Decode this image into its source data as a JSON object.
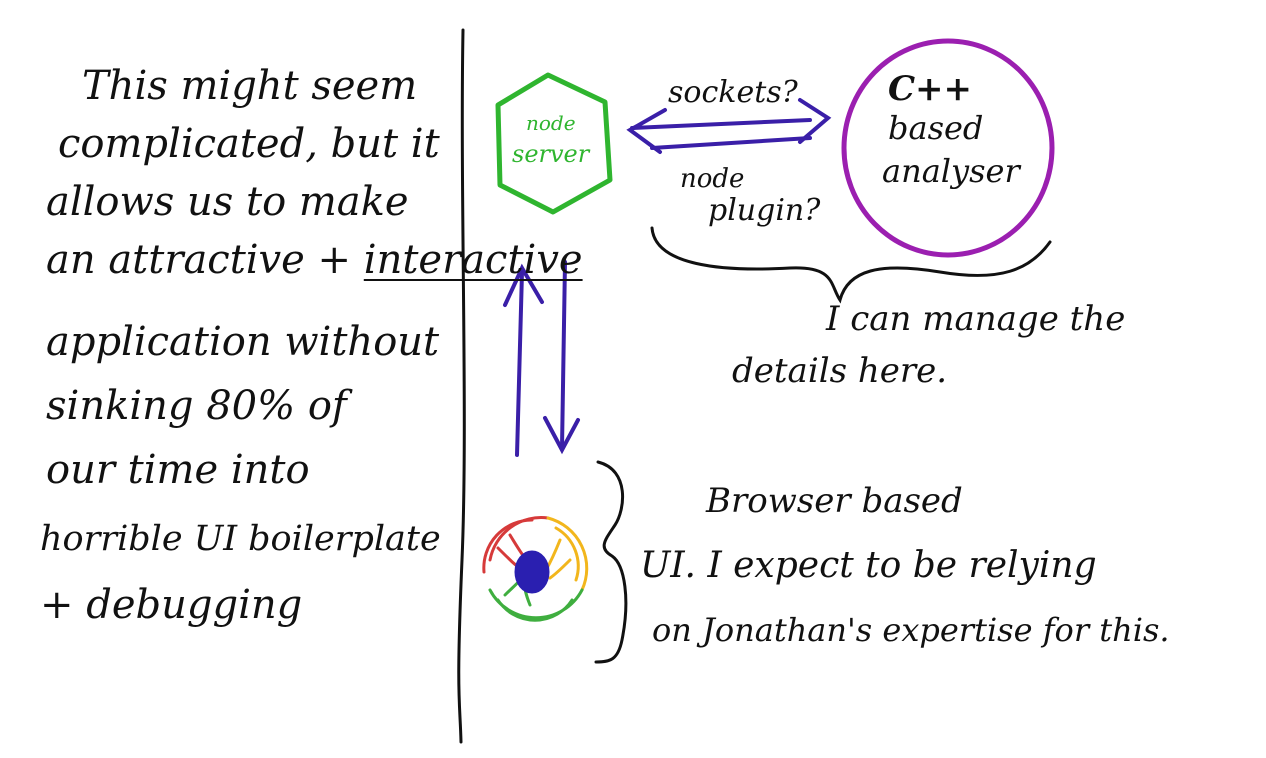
{
  "left_text": {
    "lines": [
      "This might seem",
      "complicated, but it",
      "allows us to make",
      "an attractive + ",
      "application without",
      "sinking 80% of",
      "our time into",
      "horrible UI boilerplate",
      "+ debugging"
    ],
    "underlined_word": "interactive"
  },
  "node_server": {
    "line1": "node",
    "line2": "server",
    "color": "#2fb52f"
  },
  "analyser": {
    "line1": "C++",
    "line2": "based",
    "line3": "analyser",
    "color": "#9b1fb0"
  },
  "connection": {
    "label_top": "sockets?",
    "label_bottom_1": "node",
    "label_bottom_2": "plugin?",
    "color": "#3a1fa8"
  },
  "details_note": {
    "line1": "I can manage the",
    "line2": "details here."
  },
  "browser_note": {
    "line1": "Browser based",
    "line2": "UI. I expect to be relying",
    "line3": "on Jonathan's expertise for this."
  },
  "browser_icon": {
    "name": "browser-wheel-icon",
    "colors": [
      "#d63a3a",
      "#f2b61c",
      "#3fae3f",
      "#2a1fb0"
    ]
  }
}
